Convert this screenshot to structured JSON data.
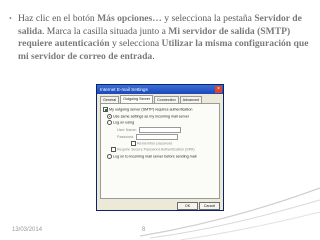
{
  "slide": {
    "bullet": "•",
    "parts": [
      "Haz clic en el botón ",
      "Más opciones…",
      " y selecciona la pestaña ",
      "Servidor de salida",
      ". Marca la casilla situada junto a ",
      "Mi servidor de salida (SMTP) requiere autenticación",
      " y selecciona ",
      "Utilizar la misma configuración que mi servidor de correo de entrada",
      "."
    ]
  },
  "window": {
    "title": "Internet E-mail Settings",
    "close_glyph": "×",
    "tabs": [
      "General",
      "Outgoing Server",
      "Connection",
      "Advanced"
    ],
    "active_tab": "Outgoing Server",
    "options": {
      "requires_auth": "My outgoing server (SMTP) requires authentication",
      "use_same": "Use same settings as my incoming mail server",
      "log_on_using": "Log on using",
      "user_name_label": "User Name:",
      "password_label": "Password:",
      "remember_password": "Remember password",
      "spa": "Require Secure Password Authentication (SPA)",
      "log_on_incoming": "Log on to incoming mail server before sending mail"
    },
    "buttons": [
      "OK",
      "Cancel"
    ]
  },
  "footer": {
    "date": "13/03/2014",
    "page_number": "8"
  },
  "colors": {
    "title_bar": "#1c48b8",
    "swoosh": "#c9c9c9"
  }
}
